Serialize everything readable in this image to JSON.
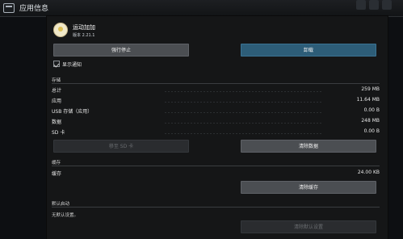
{
  "window": {
    "title": "应用信息"
  },
  "app": {
    "name": "运动加加",
    "version": "版本 2.21.1"
  },
  "actions": {
    "force_stop": "强行停止",
    "uninstall": "卸载"
  },
  "notifications": {
    "show_label": "显示通知",
    "checked": true
  },
  "storage": {
    "section_title": "存储",
    "rows": [
      {
        "label": "总计",
        "value": "259 MB"
      },
      {
        "label": "应用",
        "value": "11.64 MB"
      },
      {
        "label": "USB 存储（应用）",
        "value": "0.00 B"
      },
      {
        "label": "数据",
        "value": "248 MB"
      },
      {
        "label": "SD 卡",
        "value": "0.00 B"
      }
    ],
    "move_to_sd_label": "移至 SD 卡",
    "clear_data_label": "清除数据"
  },
  "cache": {
    "section_title": "缓存",
    "row": {
      "label": "缓存",
      "value": "24.00 KB"
    },
    "clear_cache_label": "清除缓存"
  },
  "defaults": {
    "section_title": "默认启动",
    "summary": "无默认设置。",
    "clear_defaults_label": "清除默认设置"
  }
}
